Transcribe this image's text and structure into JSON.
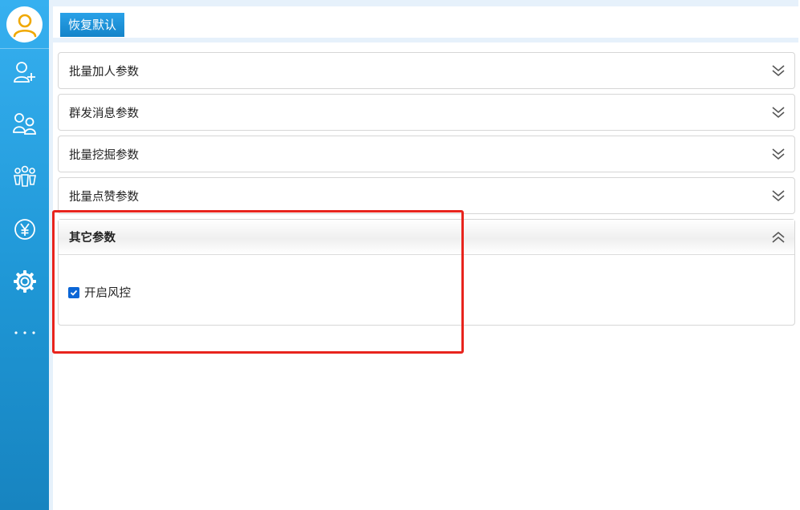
{
  "sidebar": {
    "items": [
      {
        "icon": "add-user-icon"
      },
      {
        "icon": "users-icon"
      },
      {
        "icon": "group-icon"
      },
      {
        "icon": "yuan-icon"
      },
      {
        "icon": "gear-icon"
      },
      {
        "icon": "more-icon"
      }
    ]
  },
  "toolbar": {
    "reset_label": "恢复默认"
  },
  "panels": [
    {
      "title": "批量加人参数",
      "expanded": false
    },
    {
      "title": "群发消息参数",
      "expanded": false
    },
    {
      "title": "批量挖掘参数",
      "expanded": false
    },
    {
      "title": "批量点赞参数",
      "expanded": false
    },
    {
      "title": "其它参数",
      "expanded": true,
      "options": [
        {
          "label": "开启风控",
          "checked": true
        }
      ]
    }
  ],
  "colors": {
    "sidebar_top": "#36b0f0",
    "sidebar_bottom": "#1784c0",
    "button": "#1384c9",
    "checkbox": "#0b66d6",
    "highlight": "#e8241d"
  }
}
